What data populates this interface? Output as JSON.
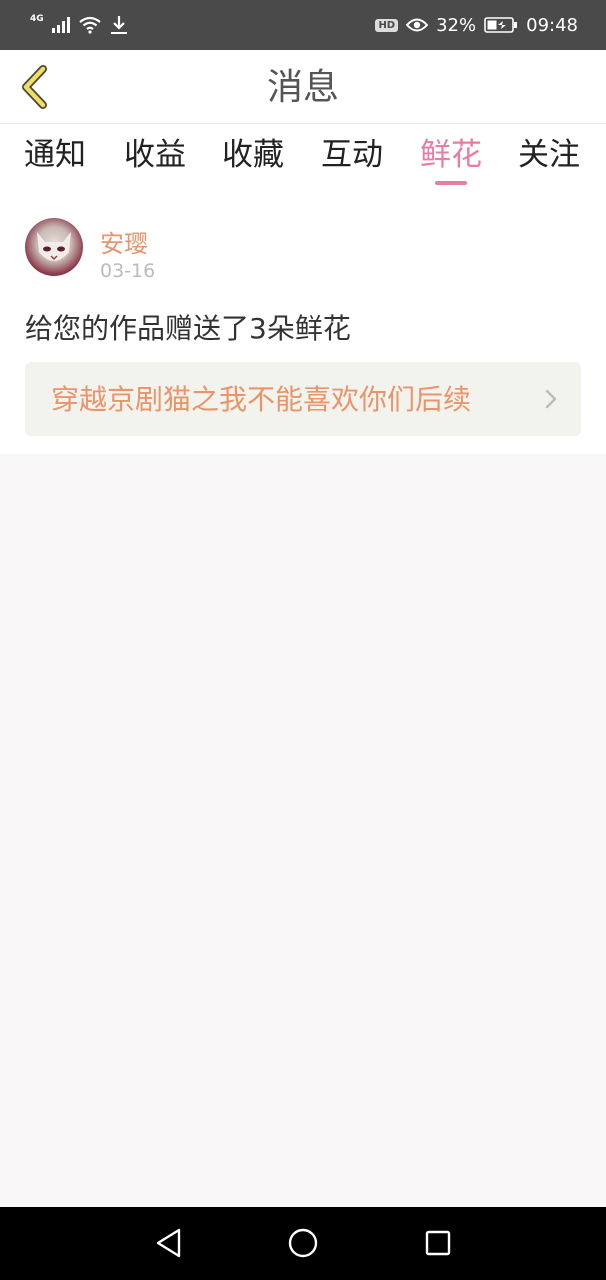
{
  "status_bar": {
    "network": "4G",
    "battery_percent": "32%",
    "time": "09:48",
    "hd_label": "HD",
    "icons": [
      "signal-icon",
      "wifi-icon",
      "download-icon",
      "eye-icon",
      "battery-icon"
    ]
  },
  "header": {
    "title": "消息",
    "back_icon": "chevron-left-icon"
  },
  "tabs": [
    {
      "label": "通知",
      "active": false
    },
    {
      "label": "收益",
      "active": false
    },
    {
      "label": "收藏",
      "active": false
    },
    {
      "label": "互动",
      "active": false
    },
    {
      "label": "鲜花",
      "active": true
    },
    {
      "label": "关注",
      "active": false
    }
  ],
  "messages": [
    {
      "username": "安璎",
      "date": "03-16",
      "text": "给您的作品赠送了3朵鲜花",
      "book_title": "穿越京剧猫之我不能喜欢你们后续",
      "avatar_icon": "avatar"
    }
  ],
  "colors": {
    "accent_pink": "#e97ca6",
    "accent_orange": "#e9946a",
    "back_icon_yellow": "#f0dc6a"
  },
  "nav_bar": {
    "icons": [
      "back-triangle-icon",
      "home-circle-icon",
      "recents-square-icon"
    ]
  }
}
